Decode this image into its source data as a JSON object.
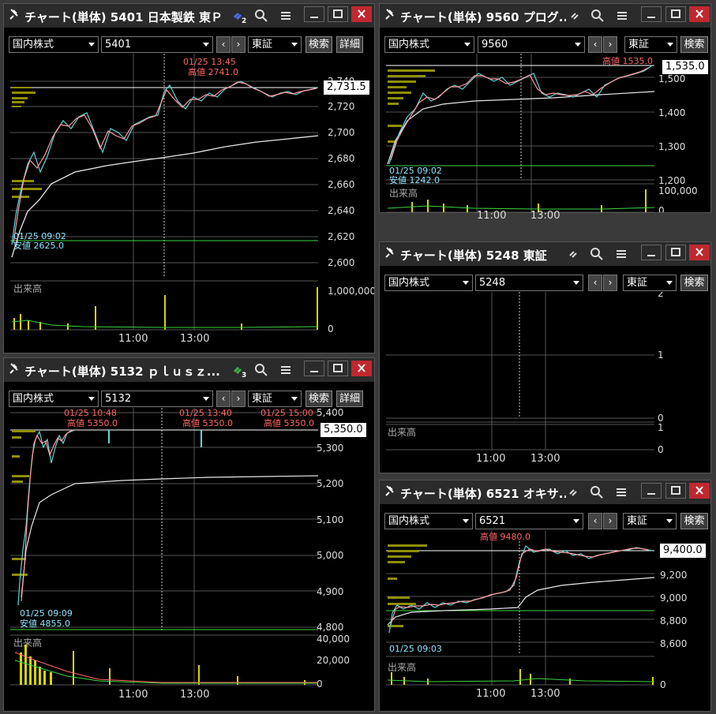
{
  "common": {
    "market": "国内株式",
    "exchange": "東証",
    "search": "検索",
    "detail": "詳細",
    "volume_label": "出来高",
    "x_ticks": [
      "11:00",
      "13:00"
    ]
  },
  "w1": {
    "title": "チャート(単体) 5401 日本製鉄 東Ｐ",
    "link_badge": "2",
    "code": "5401",
    "y_ticks": [
      "2,740",
      "2,720",
      "2,700",
      "2,680",
      "2,660",
      "2,640",
      "2,620",
      "2,600"
    ],
    "price_label": "2,731.5",
    "high_time": "01/25 13:45",
    "high_text": "高値 2741.0",
    "low_time": "01/25 09:02",
    "low_text": "安値 2625.0",
    "vol_tick": "1,000,000",
    "vol_zero": "0"
  },
  "w2": {
    "title": "チャート(単体) 9560 プログ...",
    "code": "9560",
    "y_ticks": [
      "1,500",
      "1,400",
      "1,300",
      "1,200"
    ],
    "price_label": "1,535.0",
    "high_text": "高値 1535.0",
    "low_time": "01/25 09:02",
    "low_text": "安値 1242.0",
    "vol_tick": "100,000",
    "vol_zero": "0"
  },
  "w3": {
    "title": "チャート(単体) 5248  東証",
    "code": "5248",
    "y_ticks": [
      "2",
      "1",
      "0"
    ],
    "vol_tick": "1",
    "vol_zero": "0"
  },
  "w4": {
    "title": "チャート(単体) 5132 ｐｌｕｓｚ...",
    "link_badge": "3",
    "code": "5132",
    "y_ticks": [
      "5,400",
      "5,300",
      "5,200",
      "5,100",
      "5,000",
      "4,900",
      "4,800"
    ],
    "price_label": "5,350.0",
    "high1_time": "01/25 10:48",
    "high1_text": "高値 5350.0",
    "high2_time": "01/25 13:40",
    "high2_text": "高値 5350.0",
    "high3_time": "01/25 15:00",
    "high3_text": "高値 5350.0",
    "low_time": "01/25 09:09",
    "low_text": "安値 4855.0",
    "vol_ticks": [
      "40,000",
      "20,000",
      "0"
    ]
  },
  "w5": {
    "title": "チャート(単体) 6521 オキサ...",
    "code": "6521",
    "y_ticks": [
      "9,400",
      "9,200",
      "9,000",
      "8,800",
      "8,600"
    ],
    "price_label": "9,400.0",
    "high_text": "高値 9480.0",
    "low_time": "01/25 09:03",
    "vol_zero": "0"
  },
  "colors": {
    "up": "#ff9aa0",
    "down": "#5fd6d6",
    "vwap": "#e8e8e8",
    "volume": "#d6d600",
    "green": "#3dd63d",
    "profile": "#8f8f00"
  }
}
